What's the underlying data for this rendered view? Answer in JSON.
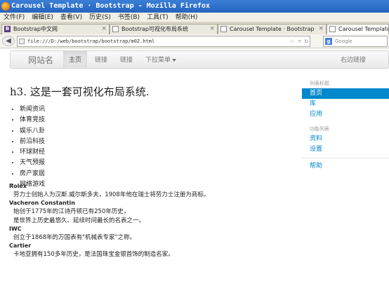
{
  "window": {
    "title": "Carousel Template · Bootstrap - Mozilla Firefox"
  },
  "menu": [
    "文件(F)",
    "编辑(E)",
    "查看(V)",
    "历史(S)",
    "书签(B)",
    "工具(T)",
    "帮助(H)"
  ],
  "tabs": [
    {
      "label": "Bootstrap中文网"
    },
    {
      "label": "Bootstrap可视化布局系统"
    },
    {
      "label": "Carousel Template · Bootstrap"
    },
    {
      "label": "Carousel Template ·"
    }
  ],
  "address": {
    "url": "file:///D:/web/bootstrap/bootstrap/m02.html"
  },
  "search": {
    "placeholder": "Google"
  },
  "site": {
    "brand": "网站名",
    "nav": [
      "主页",
      "链接",
      "链接",
      "下拉菜单"
    ],
    "right_link": "右边链接"
  },
  "content": {
    "heading": "h3. 这是一套可视化布局系统.",
    "list": [
      "新闻资讯",
      "体育竞技",
      "娱乐八卦",
      "前沿科技",
      "环球财经",
      "天气预报",
      "房产家居",
      "网络游戏"
    ],
    "descriptions": [
      {
        "term": "Rolex",
        "lines": [
          "劳力士创始人为汉斯.威尔斯多夫，1908年他在瑞士将劳力士注册为商标。"
        ]
      },
      {
        "term": "Vacheron Constantin",
        "lines": [
          "始创于1775年的江诗丹顿已有250年历史，",
          "是世界上历史最悠久、延续时间最长的名表之一。"
        ]
      },
      {
        "term": "IWC",
        "lines": [
          "创立于1868年的万国表有\"机械表专家\"之称。"
        ]
      },
      {
        "term": "Cartier",
        "lines": [
          "卡地亚拥有150多年历史，是法国珠宝金银首饰的制造名家。"
        ]
      }
    ]
  },
  "sidebar": {
    "header1": "列表标题",
    "items1": [
      "首页",
      "库",
      "应用"
    ],
    "header2": "功能列表",
    "items2": [
      "资料",
      "设置"
    ],
    "items3": [
      "帮助"
    ]
  }
}
